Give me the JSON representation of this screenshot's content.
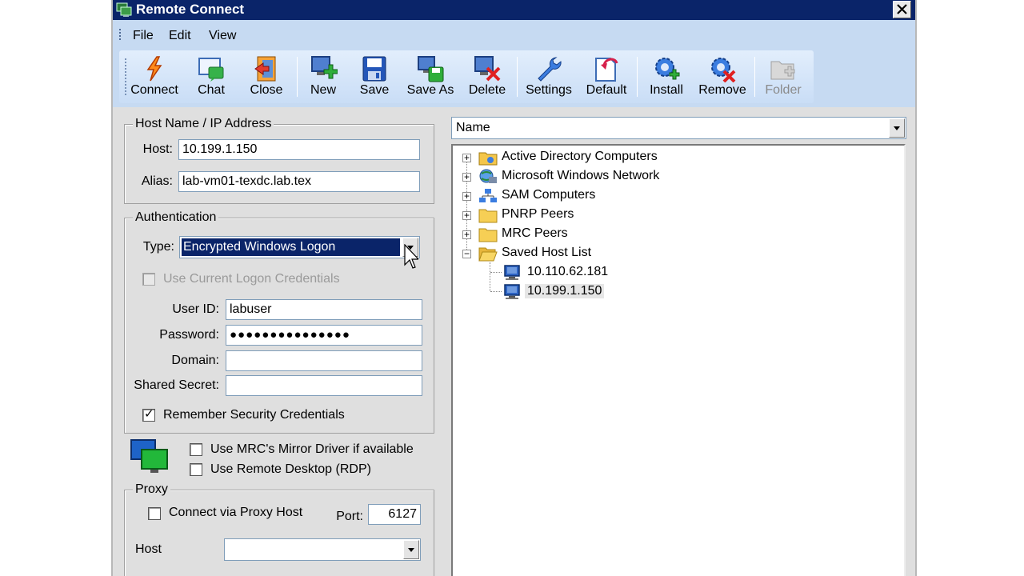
{
  "window": {
    "title": "Remote Connect"
  },
  "menu": [
    "File",
    "Edit",
    "View"
  ],
  "toolbar": [
    {
      "label": "Connect",
      "icon": "lightning-icon"
    },
    {
      "label": "Chat",
      "icon": "chat-icon"
    },
    {
      "label": "Close",
      "icon": "close-door-icon"
    },
    {
      "label": "New",
      "icon": "new-computer-icon"
    },
    {
      "label": "Save",
      "icon": "floppy-icon"
    },
    {
      "label": "Save As",
      "icon": "save-as-icon"
    },
    {
      "label": "Delete",
      "icon": "delete-computer-icon"
    },
    {
      "label": "Settings",
      "icon": "wrench-icon"
    },
    {
      "label": "Default",
      "icon": "default-icon"
    },
    {
      "label": "Install",
      "icon": "gear-add-icon"
    },
    {
      "label": "Remove",
      "icon": "gear-remove-icon"
    },
    {
      "label": "Folder",
      "icon": "folder-add-icon",
      "disabled": true
    }
  ],
  "host_group": {
    "title": "Host Name / IP Address",
    "host_label": "Host:",
    "host_value": "10.199.1.150",
    "alias_label": "Alias:",
    "alias_value": "lab-vm01-texdc.lab.tex"
  },
  "auth_group": {
    "title": "Authentication",
    "type_label": "Type:",
    "type_value": "Encrypted Windows Logon",
    "use_current_label": "Use Current Logon Credentials",
    "userid_label": "User ID:",
    "userid_value": "labuser",
    "password_label": "Password:",
    "password_value": "●●●●●●●●●●●●●●●",
    "domain_label": "Domain:",
    "domain_value": "",
    "secret_label": "Shared Secret:",
    "secret_value": "",
    "remember_label": "Remember Security Credentials",
    "remember_checked": true
  },
  "display_options": {
    "mirror_label": "Use MRC's Mirror Driver if available",
    "rdp_label": "Use Remote Desktop (RDP)"
  },
  "proxy_group": {
    "title": "Proxy",
    "via_label": "Connect via Proxy Host",
    "port_label": "Port:",
    "port_value": "6127",
    "host_label": "Host",
    "host_value": ""
  },
  "tree": {
    "column": "Name",
    "items": [
      {
        "label": "Active Directory Computers",
        "icon": "active-directory-icon"
      },
      {
        "label": "Microsoft Windows Network",
        "icon": "network-globe-icon"
      },
      {
        "label": "SAM Computers",
        "icon": "sam-network-icon"
      },
      {
        "label": "PNRP Peers",
        "icon": "folder-icon"
      },
      {
        "label": "MRC Peers",
        "icon": "folder-icon"
      },
      {
        "label": "Saved Host List",
        "icon": "folder-open-icon",
        "children": [
          "10.110.62.181",
          "10.199.1.150"
        ]
      }
    ]
  },
  "colors": {
    "title_bar": "#0a2469",
    "toolbar_bg": "#c6daf2",
    "window_bg": "#dfdfdf"
  }
}
